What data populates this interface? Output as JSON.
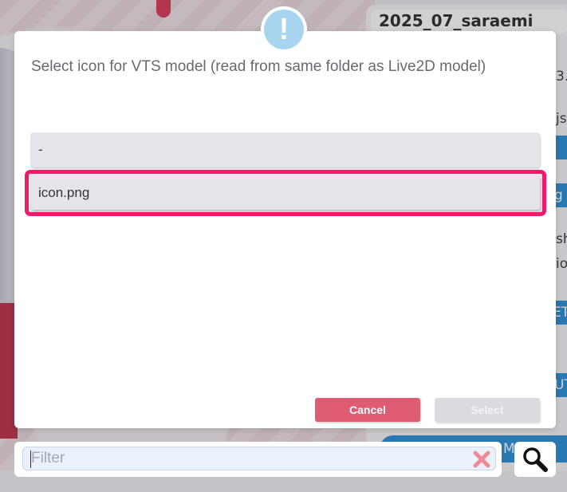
{
  "background": {
    "panel_title": "2025_07_saraemi",
    "fragments": [
      "3.",
      "jso",
      "sh",
      "io"
    ],
    "blue_bars": [
      "g",
      "ET",
      "UT"
    ],
    "bottom_bar_label": "M  TO"
  },
  "dialog": {
    "alert_icon": "exclamation-icon",
    "prompt": "Select icon for VTS model (read from same folder as Live2D model)",
    "options": [
      {
        "label": "-"
      },
      {
        "label": "icon.png",
        "selected": true
      }
    ],
    "cancel_label": "Cancel",
    "select_label": "Select"
  },
  "filter": {
    "placeholder": "Filter",
    "value": "",
    "clear_icon": "close-x-icon",
    "search_icon": "magnifier-icon"
  },
  "colors": {
    "selection_border": "#ef1a6b",
    "cancel_button": "#e05c72",
    "select_button_disabled": "#dcdae1",
    "alert_badge": "#a7d5ef",
    "accent_blue": "#1e88d2"
  }
}
